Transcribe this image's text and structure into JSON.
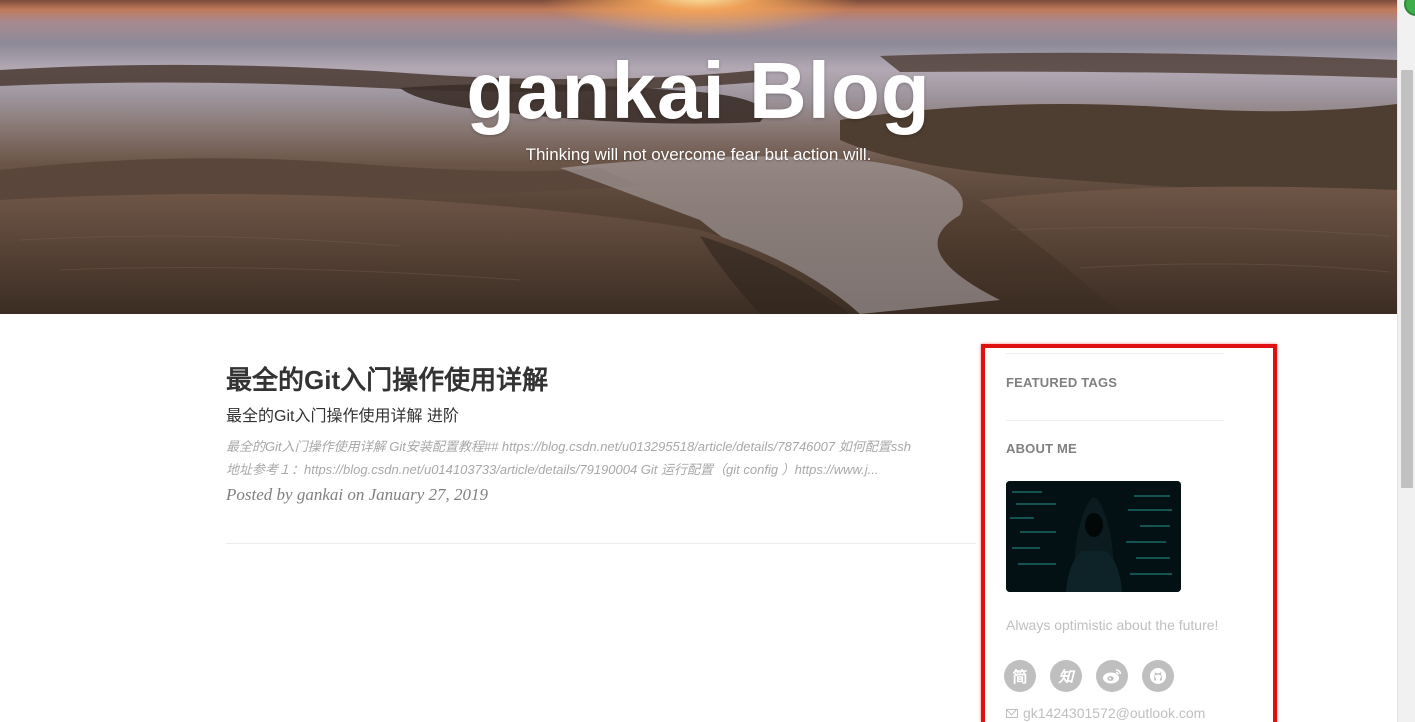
{
  "hero": {
    "title": "gankai Blog",
    "subtitle": "Thinking will not overcome fear but action will."
  },
  "post": {
    "title": "最全的Git入门操作使用详解",
    "subtitle": "最全的Git入门操作使用详解 进阶",
    "excerpt_line1": "最全的Git入门操作使用详解 Git安装配置教程## https://blog.csdn.net/u013295518/article/details/78746007 如何配置ssh",
    "excerpt_line2": "地址参考１：https://blog.csdn.net/u014103733/article/details/79190004 Git 运行配置（git config ）https://www.j...",
    "meta": "Posted by gankai on January 27, 2019"
  },
  "sidebar": {
    "featured_tags_heading": "FEATURED TAGS",
    "about_heading": "ABOUT ME",
    "motto": "Always optimistic about the future!",
    "social": [
      {
        "label": "简",
        "icon": "jianshu-icon"
      },
      {
        "label": "知",
        "icon": "zhihu-icon"
      },
      {
        "label": "weibo",
        "icon": "weibo-icon"
      },
      {
        "label": "github",
        "icon": "github-icon"
      }
    ],
    "email": "gk1424301572@outlook.com"
  },
  "colors": {
    "highlight": "#e01010",
    "social_bg": "#bfbfbf",
    "muted_text": "#bfbfbf"
  }
}
